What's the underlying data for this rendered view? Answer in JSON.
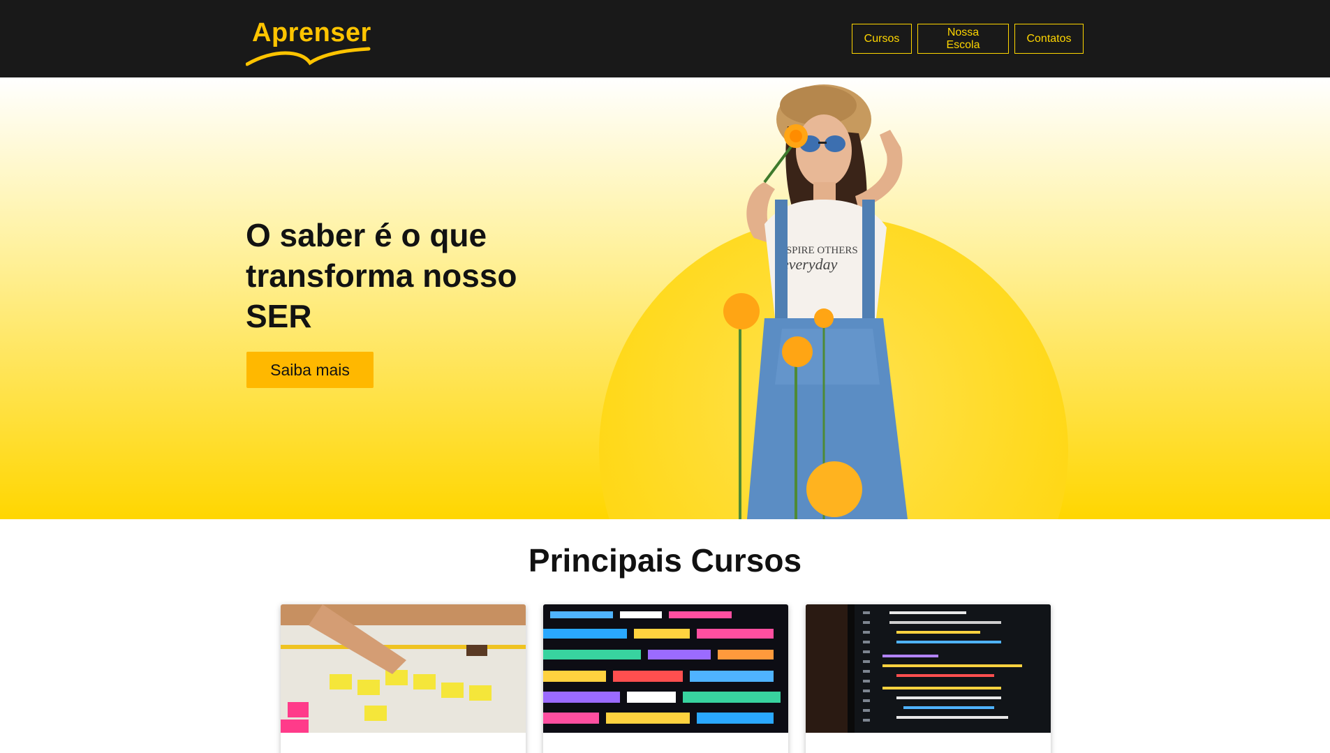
{
  "brand": {
    "name": "Aprenser",
    "accent": "#ffd600",
    "header_bg": "#191919"
  },
  "nav": {
    "items": [
      {
        "label": "Cursos"
      },
      {
        "label": "Nossa Escola"
      },
      {
        "label": "Contatos"
      }
    ]
  },
  "hero": {
    "title": "O saber é o que transforma nosso SER",
    "cta_label": "Saiba mais",
    "image_desc": "woman-with-flower-photo"
  },
  "courses": {
    "title": "Principais Cursos",
    "cards": [
      {
        "image": "sticky-notes-planning-photo"
      },
      {
        "image": "colorful-code-screen-photo"
      },
      {
        "image": "python-code-screen-photo"
      }
    ]
  }
}
